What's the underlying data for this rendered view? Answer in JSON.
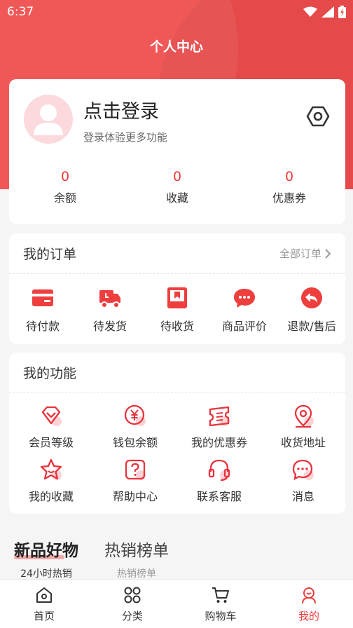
{
  "status": {
    "time": "6:37"
  },
  "header": {
    "title": "个人中心"
  },
  "profile": {
    "login_title": "点击登录",
    "login_subtitle": "登录体验更多功能",
    "stats": [
      {
        "value": "0",
        "label": "余额"
      },
      {
        "value": "0",
        "label": "收藏"
      },
      {
        "value": "0",
        "label": "优惠券"
      }
    ]
  },
  "orders": {
    "title": "我的订单",
    "more_label": "全部订单",
    "items": [
      {
        "label": "待付款",
        "icon": "wallet-card-icon"
      },
      {
        "label": "待发货",
        "icon": "truck-icon"
      },
      {
        "label": "待收货",
        "icon": "box-icon"
      },
      {
        "label": "商品评价",
        "icon": "chat-bubble-icon"
      },
      {
        "label": "退款/售后",
        "icon": "return-arrow-icon"
      }
    ]
  },
  "functions": {
    "title": "我的功能",
    "items": [
      {
        "label": "会员等级",
        "icon": "diamond-icon"
      },
      {
        "label": "钱包余额",
        "icon": "yen-coin-icon"
      },
      {
        "label": "我的优惠券",
        "icon": "ticket-icon"
      },
      {
        "label": "收货地址",
        "icon": "location-pin-icon"
      },
      {
        "label": "我的收藏",
        "icon": "star-icon"
      },
      {
        "label": "帮助中心",
        "icon": "question-icon"
      },
      {
        "label": "联系客服",
        "icon": "headset-icon"
      },
      {
        "label": "消息",
        "icon": "message-icon"
      }
    ]
  },
  "sections": [
    {
      "title": "新品好物",
      "subtitle": "24小时热销"
    },
    {
      "title": "热销榜单",
      "subtitle": "热销榜单"
    }
  ],
  "tabbar": [
    {
      "label": "首页",
      "icon": "home-icon"
    },
    {
      "label": "分类",
      "icon": "grid-icon"
    },
    {
      "label": "购物车",
      "icon": "cart-icon"
    },
    {
      "label": "我的",
      "icon": "user-icon"
    }
  ],
  "colors": {
    "accent": "#ef4c4c",
    "text": "#333333",
    "muted": "#999999"
  }
}
